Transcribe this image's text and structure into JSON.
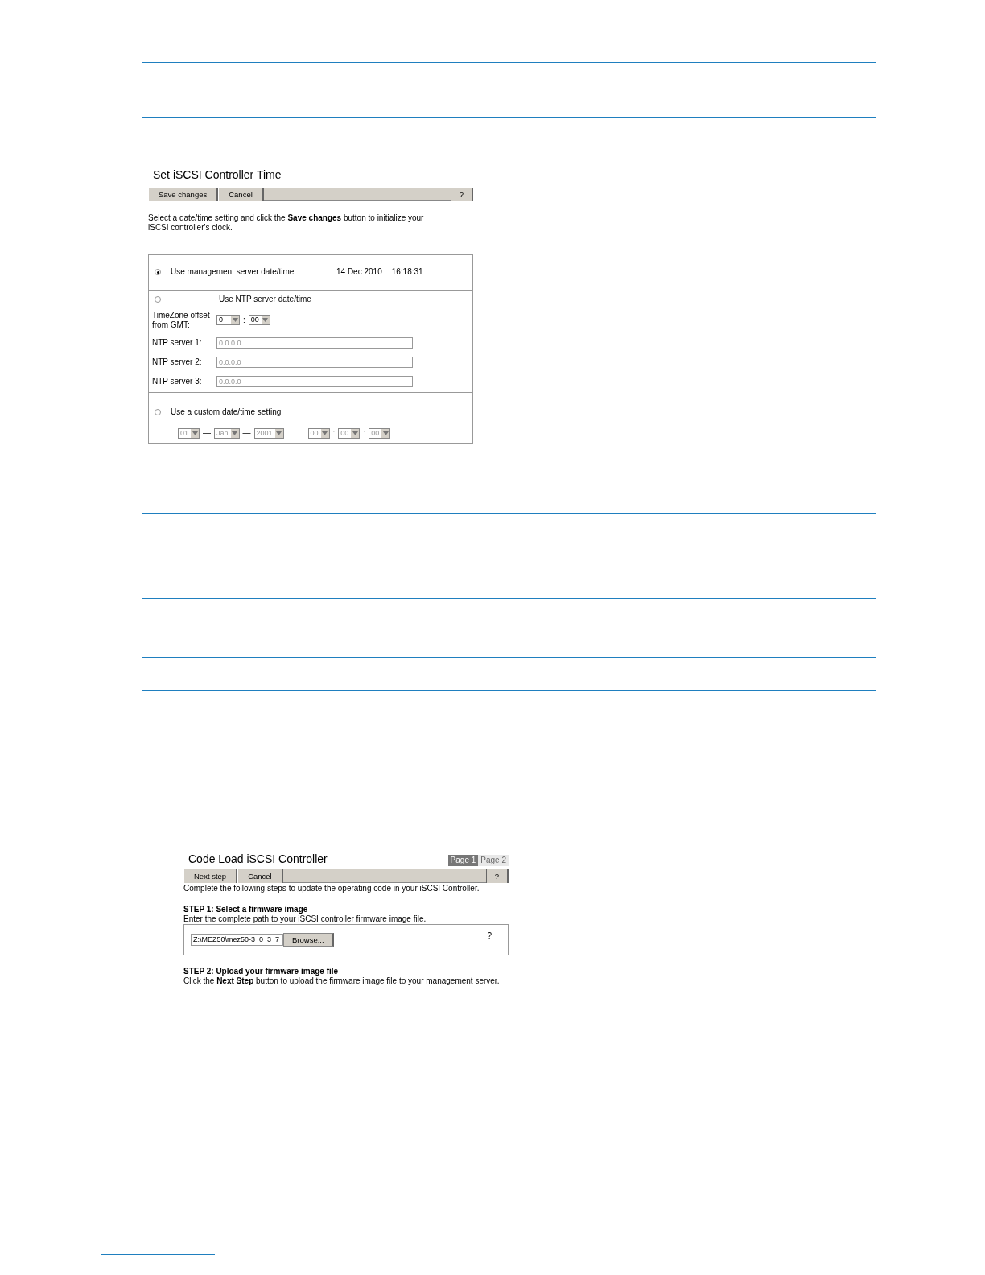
{
  "time_dialog": {
    "title": "Set iSCSI Controller Time",
    "toolbar": [
      {
        "label": "Save changes"
      },
      {
        "label": "Cancel"
      }
    ],
    "help": "?",
    "instructions": "Select a date/time setting and click the **Save changes** button to initialize your iSCSI controller's clock.",
    "options": [
      {
        "kind": "server",
        "label": "Use management server date/time",
        "selected": true,
        "date": "14 Dec 2010",
        "time": "16:18:31"
      },
      {
        "kind": "ntp",
        "label": "Use NTP server date/time",
        "selected": false,
        "timezone_label": "TimeZone offset from GMT:",
        "timezone": [
          {
            "value": "0",
            "disabled": false
          },
          {
            "value": "00",
            "disabled": false
          }
        ],
        "timezone_separator": ":",
        "servers": [
          {
            "label": "NTP server 1:",
            "value": "0.0.0.0",
            "disabled": true
          },
          {
            "label": "NTP server 2:",
            "value": "0.0.0.0",
            "disabled": true
          },
          {
            "label": "NTP server 3:",
            "value": "0.0.0.0",
            "disabled": true
          }
        ]
      },
      {
        "kind": "custom",
        "label": "Use a custom date/time setting",
        "selected": false,
        "fields": [
          {
            "kind": "select",
            "value": "01",
            "disabled": true
          },
          {
            "kind": "sep",
            "text": "—"
          },
          {
            "kind": "select",
            "value": "Jan",
            "disabled": true
          },
          {
            "kind": "sep",
            "text": "—"
          },
          {
            "kind": "select",
            "value": "2001",
            "disabled": true
          },
          {
            "kind": "gap"
          },
          {
            "kind": "select",
            "value": "00",
            "disabled": true
          },
          {
            "kind": "sep",
            "text": ":"
          },
          {
            "kind": "select",
            "value": "00",
            "disabled": true
          },
          {
            "kind": "sep",
            "text": ":"
          },
          {
            "kind": "select",
            "value": "00",
            "disabled": true
          }
        ]
      }
    ]
  },
  "code_load_dialog": {
    "title": "Code Load iSCSI Controller",
    "pages": [
      {
        "label": "Page 1",
        "selected": true
      },
      {
        "label": "Page 2",
        "selected": false
      }
    ],
    "toolbar": [
      {
        "label": "Next step"
      },
      {
        "label": "Cancel"
      }
    ],
    "help": "?",
    "intro": "Complete the following steps to update the operating code in your iSCSI Controller.",
    "step1_heading": "STEP 1: Select a firmware image",
    "step1_text": "Enter the complete path to your iSCSI controller firmware image file.",
    "file_value": "Z:\\MEZ50\\mez50-3_0_3_7",
    "browse": "Browse...",
    "field_help": "?",
    "step2_heading": "STEP 2: Upload your firmware image file",
    "step2_text": "Click the **Next Step** button to upload the firmware image file to your management server."
  }
}
